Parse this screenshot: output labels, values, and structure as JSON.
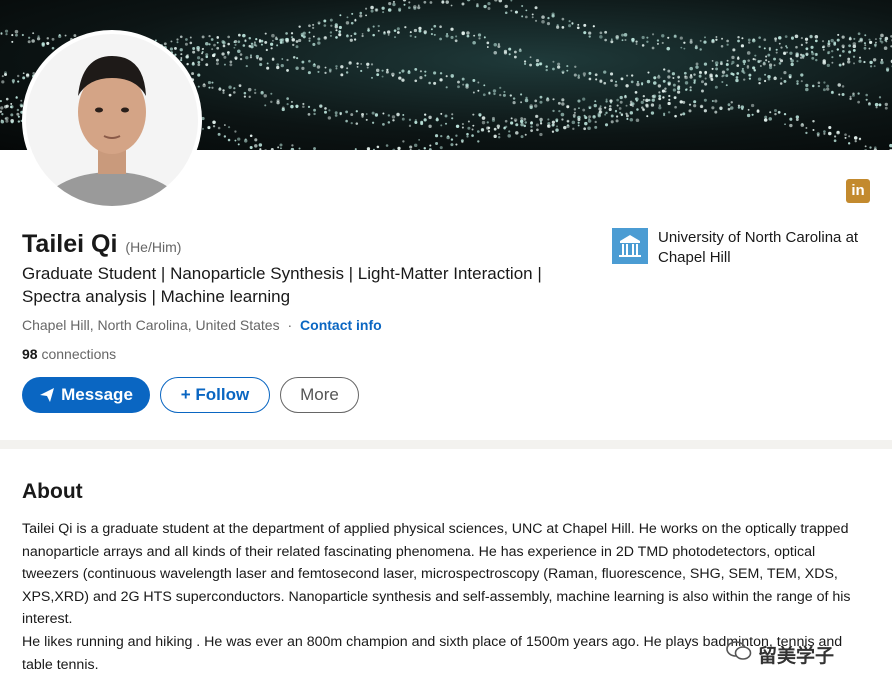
{
  "profile": {
    "name": "Tailei Qi",
    "pronouns": "(He/Him)",
    "headline": "Graduate Student | Nanoparticle Synthesis | Light-Matter Interaction | Spectra analysis | Machine learning",
    "location": "Chapel Hill, North Carolina, United States",
    "separator": "·",
    "contact_label": "Contact info",
    "connections_count": "98",
    "connections_label": "connections"
  },
  "actions": {
    "message_label": "Message",
    "follow_label": "+ Follow",
    "more_label": "More"
  },
  "education": {
    "school_name": "University of North Carolina at Chapel Hill"
  },
  "badge": {
    "linkedin_text": "in",
    "color": "#c38a2e"
  },
  "about": {
    "title": "About",
    "paragraph1": "Tailei Qi is a graduate student at the department of applied physical sciences, UNC at Chapel Hill. He works on the optically trapped nanoparticle arrays and all kinds of their related fascinating phenomena. He has experience in 2D TMD photodetectors, optical tweezers (continuous wavelength laser and femtosecond laser, microspectroscopy (Raman, fluorescence, SHG, SEM, TEM, XDS, XPS,XRD) and 2G HTS superconductors. Nanoparticle synthesis and self-assembly, machine learning is also within the range of his interest.",
    "paragraph2": "He likes running and hiking . He was ever an 800m champion and sixth place of 1500m years ago. He plays badminton, tennis and table tennis."
  },
  "watermark": {
    "text": "留美学子"
  },
  "colors": {
    "accent": "#0a66c2",
    "text_secondary": "#666666",
    "unc_blue": "#4b9cd3"
  }
}
